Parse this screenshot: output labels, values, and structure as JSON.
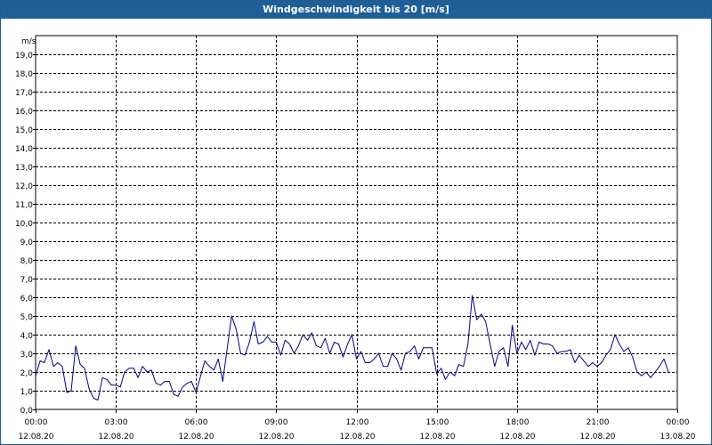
{
  "window": {
    "title": "Windgeschwindigkeit bis 20 [m/s]"
  },
  "chart_data": {
    "type": "line",
    "title": "Windgeschwindigkeit bis 20 [m/s]",
    "ylabel": "m/s",
    "xlabel": "",
    "ylim": [
      0,
      20
    ],
    "xlim_hours": [
      0,
      24
    ],
    "y_ticks": [
      "0,0",
      "1,0",
      "2,0",
      "3,0",
      "4,0",
      "5,0",
      "6,0",
      "7,0",
      "8,0",
      "9,0",
      "10,0",
      "11,0",
      "12,0",
      "13,0",
      "14,0",
      "15,0",
      "16,0",
      "17,0",
      "18,0",
      "19,0"
    ],
    "x_ticks": [
      {
        "time": "00:00",
        "date": "12.08.20"
      },
      {
        "time": "03:00",
        "date": "12.08.20"
      },
      {
        "time": "06:00",
        "date": "12.08.20"
      },
      {
        "time": "09:00",
        "date": "12.08.20"
      },
      {
        "time": "12:00",
        "date": "12.08.20"
      },
      {
        "time": "15:00",
        "date": "12.08.20"
      },
      {
        "time": "18:00",
        "date": "12.08.20"
      },
      {
        "time": "21:00",
        "date": "12.08.20"
      },
      {
        "time": "00:00",
        "date": "13.08.20"
      }
    ],
    "grid": true,
    "line_color": "#00008b",
    "series": [
      {
        "name": "",
        "x_hours": [
          0.0,
          0.17,
          0.33,
          0.5,
          0.67,
          0.83,
          1.0,
          1.17,
          1.33,
          1.5,
          1.67,
          1.83,
          2.0,
          2.17,
          2.33,
          2.5,
          2.67,
          2.83,
          3.0,
          3.17,
          3.33,
          3.5,
          3.67,
          3.83,
          4.0,
          4.17,
          4.33,
          4.5,
          4.67,
          4.83,
          5.0,
          5.17,
          5.33,
          5.5,
          5.67,
          5.83,
          6.0,
          6.17,
          6.33,
          6.5,
          6.67,
          6.83,
          7.0,
          7.17,
          7.33,
          7.5,
          7.67,
          7.83,
          8.0,
          8.17,
          8.33,
          8.5,
          8.67,
          8.83,
          9.0,
          9.17,
          9.33,
          9.5,
          9.67,
          9.83,
          10.0,
          10.17,
          10.33,
          10.5,
          10.67,
          10.83,
          11.0,
          11.17,
          11.33,
          11.5,
          11.67,
          11.83,
          12.0,
          12.17,
          12.33,
          12.5,
          12.67,
          12.83,
          13.0,
          13.17,
          13.33,
          13.5,
          13.67,
          13.83,
          14.0,
          14.17,
          14.33,
          14.5,
          14.67,
          14.83,
          15.0,
          15.17,
          15.33,
          15.5,
          15.67,
          15.83,
          16.0,
          16.17,
          16.33,
          16.5,
          16.67,
          16.83,
          17.0,
          17.17,
          17.33,
          17.5,
          17.67,
          17.83,
          18.0,
          18.17,
          18.33,
          18.5,
          18.67,
          18.83,
          19.0,
          19.17,
          19.33,
          19.5,
          19.67,
          19.83,
          20.0,
          20.17,
          20.33,
          20.5,
          20.67,
          20.83,
          21.0,
          21.17,
          21.33,
          21.5,
          21.67,
          21.83,
          22.0,
          22.17,
          22.33,
          22.5,
          22.67,
          22.83,
          23.0,
          23.17,
          23.33,
          23.5,
          23.67,
          23.83,
          24.0
        ],
        "values": [
          1.8,
          2.6,
          2.5,
          3.2,
          2.3,
          2.5,
          2.3,
          0.9,
          1.0,
          3.4,
          2.4,
          2.2,
          1.1,
          0.6,
          0.5,
          1.7,
          1.6,
          1.3,
          1.3,
          1.2,
          2.0,
          2.2,
          2.2,
          1.7,
          2.3,
          2.0,
          2.1,
          1.4,
          1.3,
          1.5,
          1.5,
          0.8,
          0.7,
          1.2,
          1.4,
          1.5,
          0.9,
          1.8,
          2.6,
          2.3,
          2.1,
          2.7,
          1.5,
          3.3,
          5.0,
          4.3,
          3.0,
          2.9,
          3.6,
          4.7,
          3.5,
          3.6,
          3.9,
          3.6,
          3.6,
          2.9,
          3.7,
          3.5,
          3.0,
          3.4,
          4.0,
          3.7,
          4.1,
          3.4,
          3.3,
          3.8,
          3.0,
          3.6,
          3.5,
          2.8,
          3.5,
          4.0,
          2.7,
          3.1,
          2.5,
          2.5,
          2.7,
          3.0,
          2.3,
          2.3,
          3.0,
          2.7,
          2.1,
          3.0,
          3.1,
          3.4,
          2.7,
          3.3,
          3.3,
          3.3,
          1.9,
          2.2,
          1.6,
          2.0,
          1.8,
          2.4,
          2.3,
          3.5,
          6.1,
          4.8,
          5.1,
          4.7,
          3.5,
          2.3,
          3.1,
          3.3,
          2.3,
          4.5,
          3.0,
          3.6,
          3.2,
          3.7,
          2.9,
          3.6,
          3.5,
          3.5,
          3.4,
          3.0,
          3.1,
          3.1,
          3.2,
          2.5,
          2.9,
          2.6,
          2.3,
          2.5,
          2.3,
          2.5,
          2.9,
          3.2,
          4.0,
          3.5,
          3.1,
          3.3,
          2.8,
          2.0,
          1.8,
          2.0,
          1.7,
          2.0,
          2.3,
          2.7,
          2.0
        ]
      }
    ]
  }
}
